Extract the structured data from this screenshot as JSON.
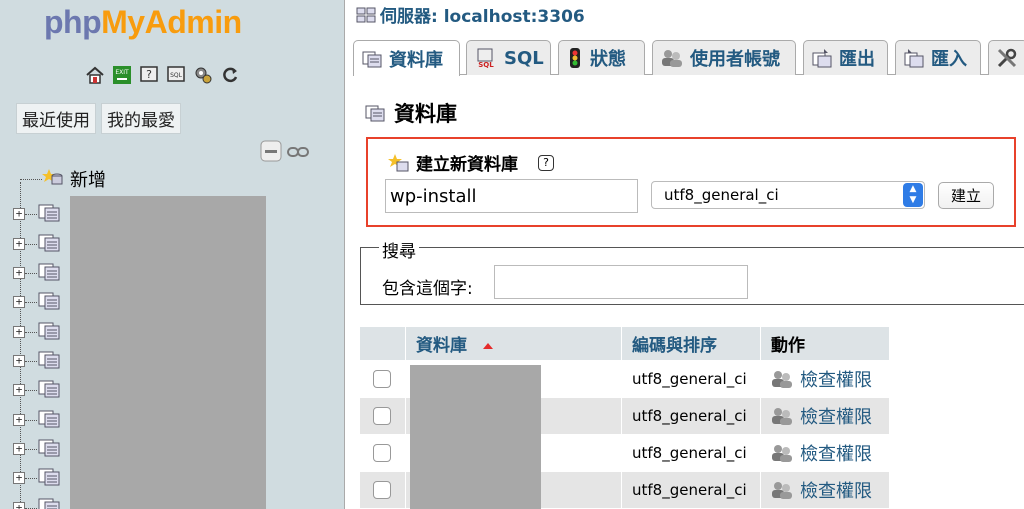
{
  "nav": {
    "logo": {
      "part1": "php",
      "part2": "MyAdmin"
    },
    "toolbar_icons": [
      "home-icon",
      "exit-icon",
      "help-icon",
      "sql-docs-icon",
      "settings-icon",
      "reload-icon"
    ],
    "tabs": [
      "最近使用",
      "我的最愛"
    ],
    "tree": {
      "new_label": "新增",
      "db_rows": 11
    }
  },
  "header": {
    "server_label": "伺服器: localhost:3306"
  },
  "tabs": [
    {
      "label": "資料庫",
      "icon": "database-icon",
      "active": true
    },
    {
      "label": "SQL",
      "icon": "sql-icon"
    },
    {
      "label": "狀態",
      "icon": "status-icon"
    },
    {
      "label": "使用者帳號",
      "icon": "users-icon"
    },
    {
      "label": "匯出",
      "icon": "export-icon"
    },
    {
      "label": "匯入",
      "icon": "import-icon"
    },
    {
      "label": "",
      "icon": "settings-icon"
    }
  ],
  "main": {
    "title": "資料庫",
    "create": {
      "heading": "建立新資料庫",
      "name_value": "wp-install",
      "collation_value": "utf8_general_ci",
      "button_label": "建立",
      "help_glyph": "?"
    },
    "search": {
      "legend": "搜尋",
      "label": "包含這個字:",
      "value": ""
    },
    "table": {
      "headers": {
        "database": "資料庫",
        "collation": "編碼與排序",
        "action": "動作"
      },
      "rows": [
        {
          "collation": "utf8_general_ci",
          "action": "檢查權限"
        },
        {
          "collation": "utf8_general_ci",
          "action": "檢查權限"
        },
        {
          "collation": "utf8_general_ci",
          "action": "檢查權限"
        },
        {
          "collation": "utf8_general_ci",
          "action": "檢查權限"
        }
      ]
    }
  },
  "colors": {
    "link": "#235a81",
    "highlight_border": "#e8412b",
    "nav_bg": "#d0dce0"
  }
}
